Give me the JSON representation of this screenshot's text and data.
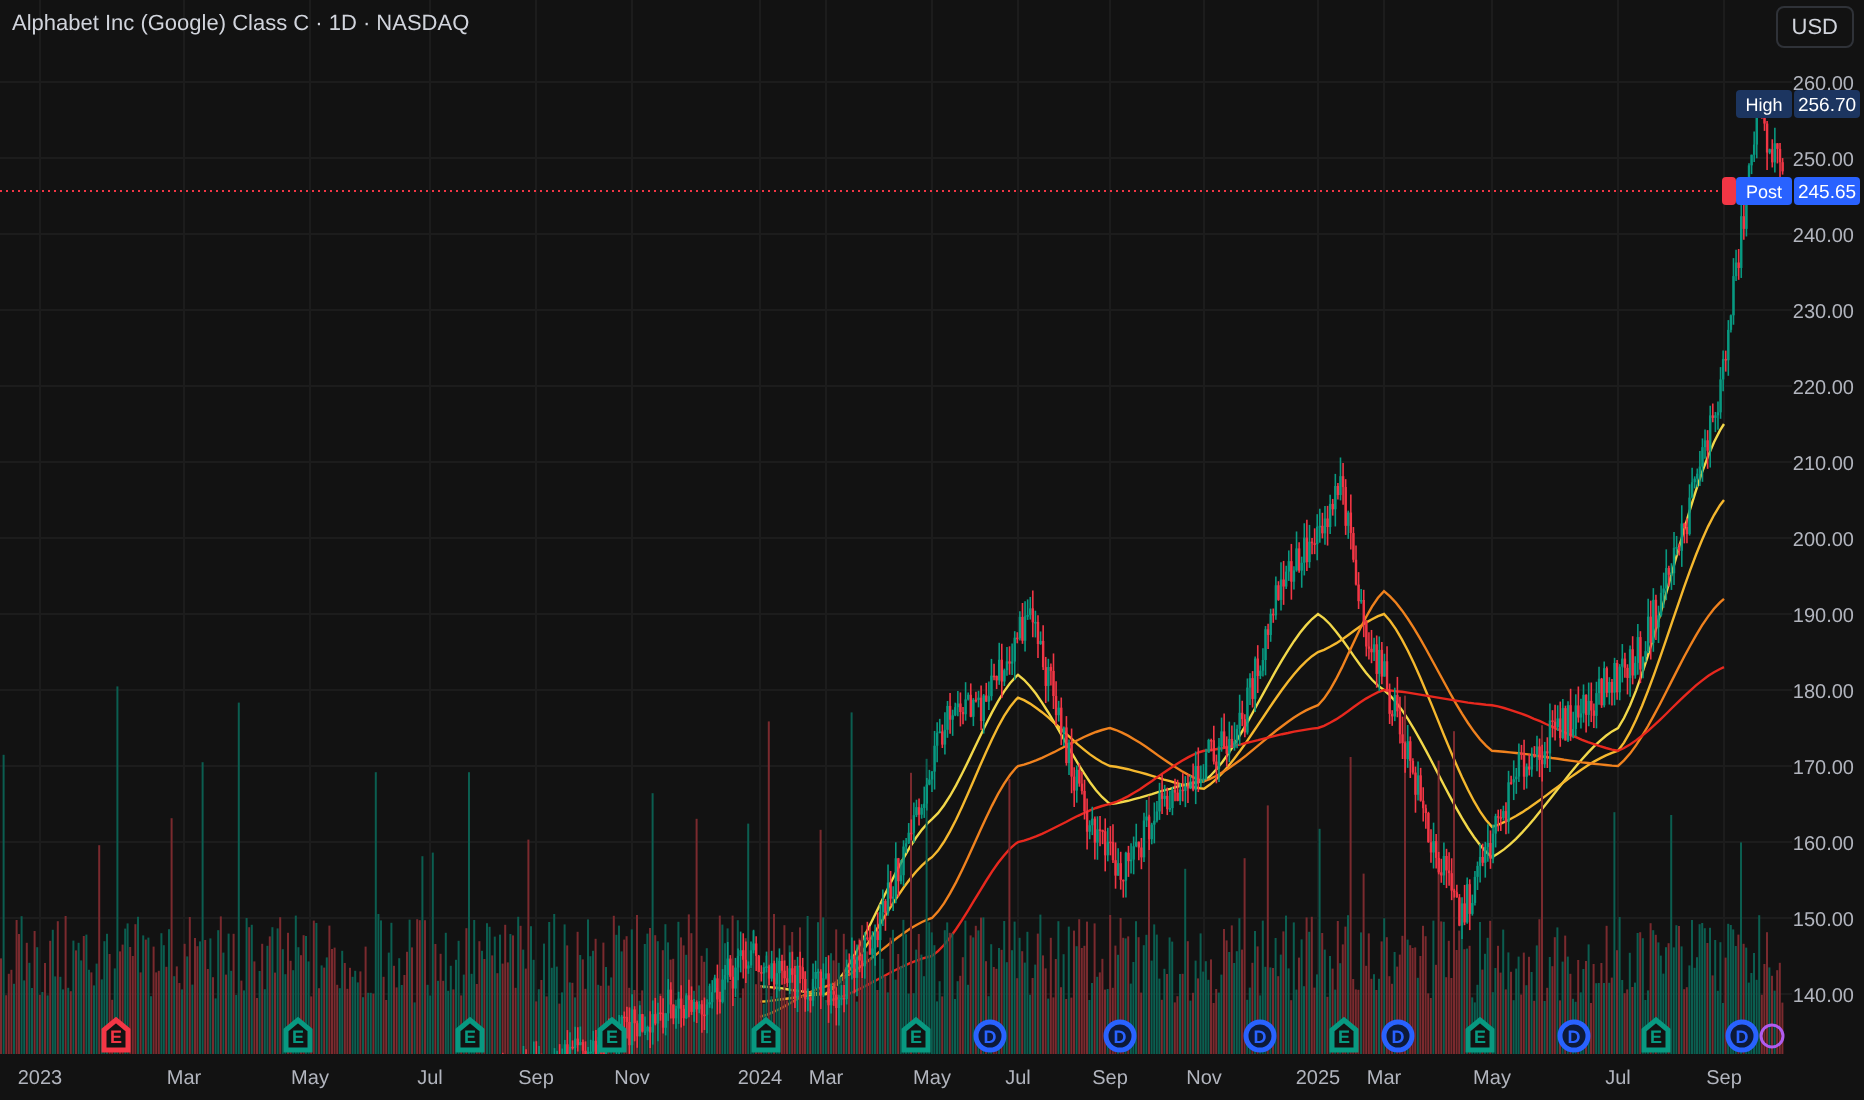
{
  "title": "Alphabet Inc (Google) Class C · 1D · NASDAQ",
  "currency_button": "USD",
  "high_label": {
    "label": "High",
    "value": "256.70"
  },
  "post_label": {
    "label": "Post",
    "value": "245.65"
  },
  "chart_data": {
    "type": "line",
    "grid": true,
    "ylim": [
      132.1,
      270.8
    ],
    "categories": [
      "2023",
      "Mar",
      "May",
      "Jul",
      "Sep",
      "Nov",
      "2024",
      "Mar",
      "May",
      "Jul",
      "Sep",
      "Nov",
      "2025",
      "Mar",
      "May",
      "Jul",
      "Sep"
    ],
    "yticks": [
      {
        "value": 260,
        "label": "260.00"
      },
      {
        "value": 250,
        "label": "250.00"
      },
      {
        "value": 240,
        "label": "240.00"
      },
      {
        "value": 230,
        "label": "230.00"
      },
      {
        "value": 220,
        "label": "220.00"
      },
      {
        "value": 210,
        "label": "210.00"
      },
      {
        "value": 200,
        "label": "200.00"
      },
      {
        "value": 190,
        "label": "190.00"
      },
      {
        "value": 180,
        "label": "180.00"
      },
      {
        "value": 170,
        "label": "170.00"
      },
      {
        "value": 160,
        "label": "160.00"
      },
      {
        "value": 150,
        "label": "150.00"
      },
      {
        "value": 140,
        "label": "140.00"
      }
    ],
    "series": [
      {
        "color": "#f2d84a",
        "values": [
          null,
          null,
          null,
          null,
          null,
          null,
          141,
          140,
          163,
          182,
          165,
          168,
          190,
          180,
          158,
          175,
          215
        ]
      },
      {
        "color": "#f5b82e",
        "values": [
          null,
          null,
          null,
          null,
          null,
          null,
          139,
          140,
          158,
          179,
          170,
          167,
          185,
          190,
          162,
          172,
          205
        ]
      },
      {
        "color": "#f0821e",
        "values": [
          null,
          null,
          null,
          null,
          null,
          null,
          137,
          141,
          150,
          170,
          175,
          168,
          178,
          193,
          172,
          170,
          192
        ]
      },
      {
        "color": "#e8281e",
        "values": [
          null,
          null,
          null,
          null,
          null,
          null,
          null,
          139,
          145,
          160,
          165,
          172,
          175,
          180,
          178,
          172,
          183
        ]
      }
    ]
  },
  "events": [
    {
      "kind": "earnings",
      "label": "E",
      "color": "#f23645"
    },
    {
      "kind": "earnings",
      "label": "E",
      "color": "#089981"
    },
    {
      "kind": "earnings",
      "label": "E",
      "color": "#089981"
    },
    {
      "kind": "earnings",
      "label": "E",
      "color": "#089981"
    },
    {
      "kind": "earnings",
      "label": "E",
      "color": "#089981"
    },
    {
      "kind": "earnings",
      "label": "E",
      "color": "#089981"
    },
    {
      "kind": "dividend",
      "label": "D",
      "color": "#2962ff"
    },
    {
      "kind": "dividend",
      "label": "D",
      "color": "#2962ff"
    },
    {
      "kind": "dividend",
      "label": "D",
      "color": "#2962ff"
    },
    {
      "kind": "earnings",
      "label": "E",
      "color": "#089981"
    },
    {
      "kind": "dividend",
      "label": "D",
      "color": "#2962ff"
    },
    {
      "kind": "earnings",
      "label": "E",
      "color": "#089981"
    },
    {
      "kind": "dividend",
      "label": "D",
      "color": "#2962ff"
    },
    {
      "kind": "earnings",
      "label": "E",
      "color": "#089981"
    },
    {
      "kind": "dividend",
      "label": "D",
      "color": "#2962ff"
    }
  ]
}
